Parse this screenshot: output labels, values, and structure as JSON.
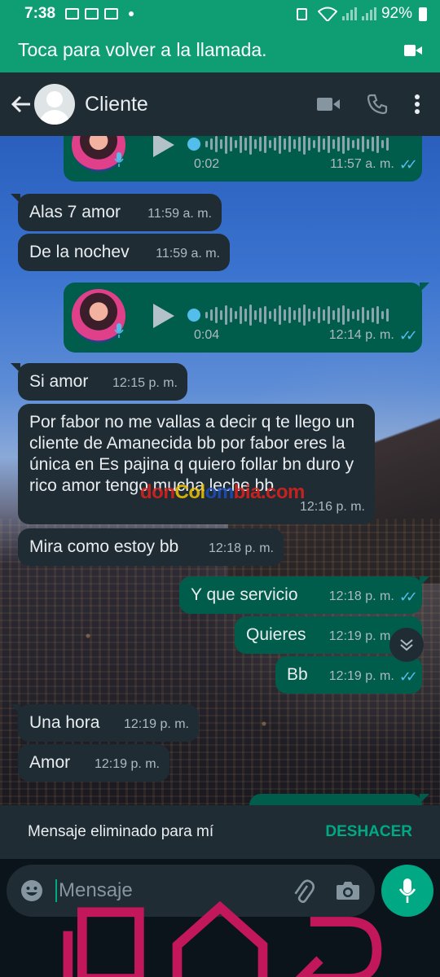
{
  "status_bar": {
    "time": "7:38",
    "battery": "92%"
  },
  "call_banner": {
    "text": "Toca para volver a la llamada."
  },
  "header": {
    "contact_name": "Cliente"
  },
  "messages": [
    {
      "type": "voice",
      "dir": "out",
      "duration": "0:02",
      "time": "11:57 a. m."
    },
    {
      "type": "text",
      "dir": "in",
      "text": "Alas 7 amor",
      "time": "11:59 a. m."
    },
    {
      "type": "text",
      "dir": "in",
      "text": "De la nochev",
      "time": "11:59 a. m."
    },
    {
      "type": "voice",
      "dir": "out",
      "duration": "0:04",
      "time": "12:14 p. m."
    },
    {
      "type": "text",
      "dir": "in",
      "text": "Si amor",
      "time": "12:15 p. m."
    },
    {
      "type": "text",
      "dir": "in",
      "text": "Por fabor no me vallas a decir q te llego un cliente de Amanecida bb por fabor eres la única en Es pajina q quiero follar bn duro y rico amor tengo mucha leche bb",
      "time": "12:16 p. m."
    },
    {
      "type": "text",
      "dir": "in",
      "text": "Mira como estoy bb",
      "time": "12:18 p. m."
    },
    {
      "type": "text",
      "dir": "out",
      "text": "Y  que servicio",
      "time": "12:18 p. m."
    },
    {
      "type": "text",
      "dir": "out",
      "text": "Quieres",
      "time": "12:19 p. m."
    },
    {
      "type": "text",
      "dir": "out",
      "text": "Bb",
      "time": "12:19 p. m."
    },
    {
      "type": "text",
      "dir": "in",
      "text": "Una hora",
      "time": "12:19 p. m."
    },
    {
      "type": "text",
      "dir": "in",
      "text": "Amor",
      "time": "12:19 p. m."
    }
  ],
  "watermark": {
    "text": "donColombia.com"
  },
  "snackbar": {
    "message": "Mensaje eliminado para mí",
    "action": "DESHACER"
  },
  "composer": {
    "placeholder": "Mensaje"
  },
  "colors": {
    "accent": "#00a884",
    "outgoing": "#005c4b",
    "incoming": "#1f2c34",
    "read_ticks": "#53bdeb"
  }
}
